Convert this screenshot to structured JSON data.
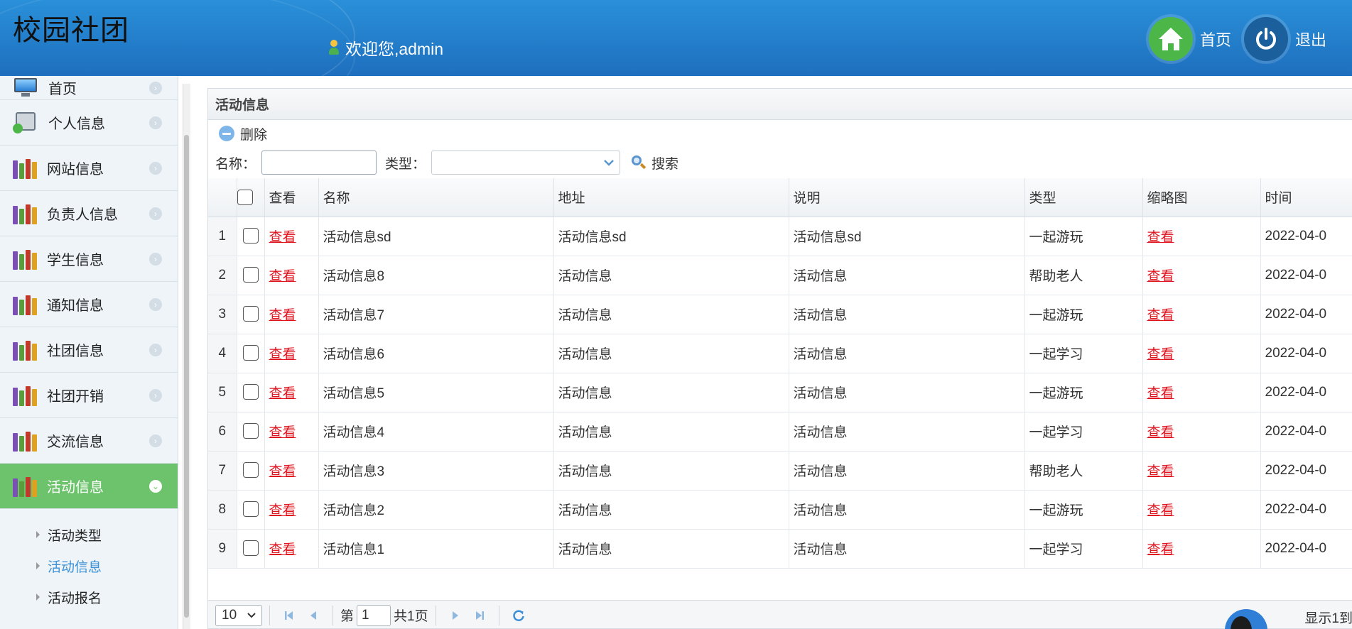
{
  "header": {
    "app_title": "校园社团",
    "welcome": "欢迎您,admin",
    "home_label": "首页",
    "logout_label": "退出"
  },
  "sidebar": {
    "items": [
      {
        "label": "首页",
        "icon": "monitor-icon"
      },
      {
        "label": "个人信息",
        "icon": "computer-icon"
      },
      {
        "label": "网站信息",
        "icon": "books-icon"
      },
      {
        "label": "负责人信息",
        "icon": "books-icon"
      },
      {
        "label": "学生信息",
        "icon": "books-icon"
      },
      {
        "label": "通知信息",
        "icon": "books-icon"
      },
      {
        "label": "社团信息",
        "icon": "books-icon"
      },
      {
        "label": "社团开销",
        "icon": "books-icon"
      },
      {
        "label": "交流信息",
        "icon": "books-icon"
      },
      {
        "label": "活动信息",
        "icon": "books-icon",
        "active": true
      }
    ],
    "sub_items": [
      {
        "label": "活动类型"
      },
      {
        "label": "活动信息",
        "current": true
      },
      {
        "label": "活动报名"
      }
    ]
  },
  "panel": {
    "title": "活动信息",
    "delete_label": "删除",
    "name_label": "名称：",
    "name_value": "",
    "type_label": "类型：",
    "type_value": "",
    "search_label": "搜索"
  },
  "table": {
    "columns": [
      "查看",
      "名称",
      "地址",
      "说明",
      "类型",
      "缩略图",
      "时间"
    ],
    "rows": [
      {
        "n": "1",
        "view": "查看",
        "name": "活动信息sd",
        "addr": "活动信息sd",
        "desc": "活动信息sd",
        "type": "一起游玩",
        "thumb": "查看",
        "time": "2022-04-0"
      },
      {
        "n": "2",
        "view": "查看",
        "name": "活动信息8",
        "addr": "活动信息",
        "desc": "活动信息",
        "type": "帮助老人",
        "thumb": "查看",
        "time": "2022-04-0"
      },
      {
        "n": "3",
        "view": "查看",
        "name": "活动信息7",
        "addr": "活动信息",
        "desc": "活动信息",
        "type": "一起游玩",
        "thumb": "查看",
        "time": "2022-04-0"
      },
      {
        "n": "4",
        "view": "查看",
        "name": "活动信息6",
        "addr": "活动信息",
        "desc": "活动信息",
        "type": "一起学习",
        "thumb": "查看",
        "time": "2022-04-0"
      },
      {
        "n": "5",
        "view": "查看",
        "name": "活动信息5",
        "addr": "活动信息",
        "desc": "活动信息",
        "type": "一起游玩",
        "thumb": "查看",
        "time": "2022-04-0"
      },
      {
        "n": "6",
        "view": "查看",
        "name": "活动信息4",
        "addr": "活动信息",
        "desc": "活动信息",
        "type": "一起学习",
        "thumb": "查看",
        "time": "2022-04-0"
      },
      {
        "n": "7",
        "view": "查看",
        "name": "活动信息3",
        "addr": "活动信息",
        "desc": "活动信息",
        "type": "帮助老人",
        "thumb": "查看",
        "time": "2022-04-0"
      },
      {
        "n": "8",
        "view": "查看",
        "name": "活动信息2",
        "addr": "活动信息",
        "desc": "活动信息",
        "type": "一起游玩",
        "thumb": "查看",
        "time": "2022-04-0"
      },
      {
        "n": "9",
        "view": "查看",
        "name": "活动信息1",
        "addr": "活动信息",
        "desc": "活动信息",
        "type": "一起学习",
        "thumb": "查看",
        "time": "2022-04-0"
      }
    ]
  },
  "pager": {
    "page_size": "10",
    "page_prefix": "第",
    "page_value": "1",
    "page_total": "共1页",
    "display": "显示1到"
  },
  "colors": {
    "header_blue": "#2a90d9",
    "active_green": "#6cc36b",
    "link_red": "#e0141e",
    "current_sub": "#3a8fd6"
  }
}
